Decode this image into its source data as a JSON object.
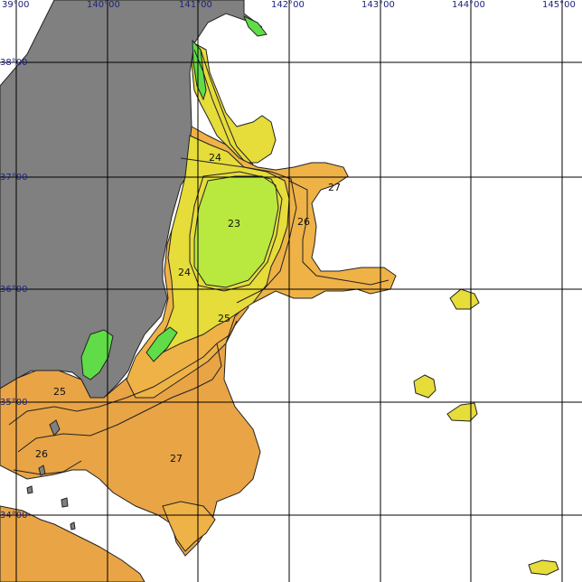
{
  "map": {
    "longitude_labels": [
      "39°00",
      "140°00",
      "141°00",
      "142°00",
      "143°00",
      "144°00",
      "145°00"
    ],
    "latitude_labels": [
      "38°00",
      "37°00",
      "36°00",
      "35°00",
      "34°00"
    ],
    "contour_labels": [
      "24",
      "27",
      "23",
      "26",
      "24",
      "25",
      "25",
      "26",
      "27"
    ],
    "colors": {
      "land": "#808080",
      "water": "#ffffff",
      "temp_23": "#b9e83f",
      "temp_24": "#e6dc3a",
      "temp_25": "#efc445",
      "temp_26": "#eeb246",
      "temp_27": "#e9a445",
      "temp_cold": "#5fdc48",
      "grid": "#000000",
      "label": "#1a237e"
    }
  }
}
